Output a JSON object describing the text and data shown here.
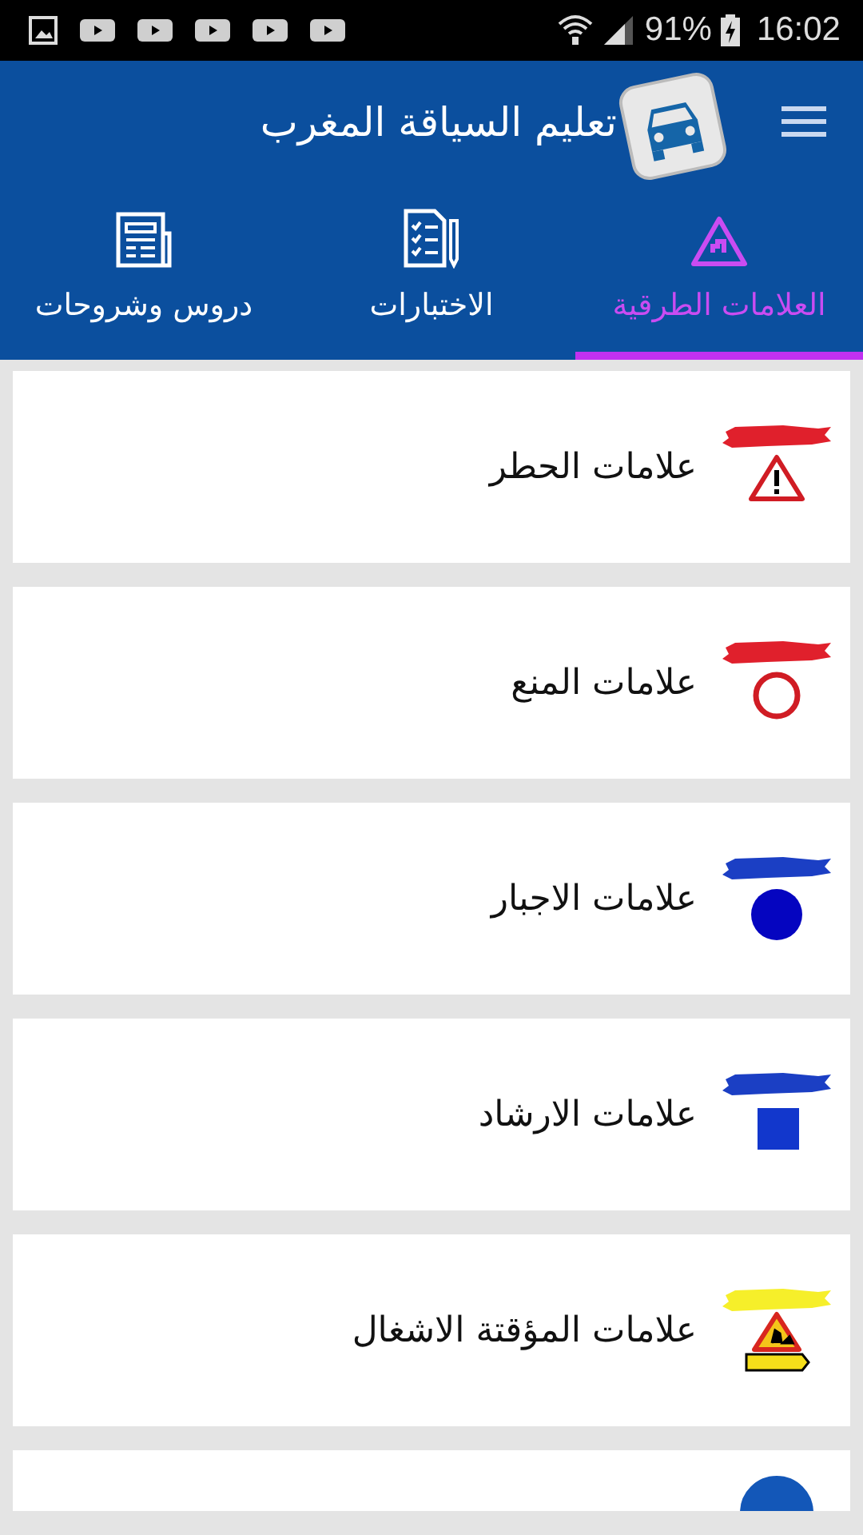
{
  "status_bar": {
    "battery": "91%",
    "time": "16:02"
  },
  "app_bar": {
    "title": "تعليم السياقة المغرب"
  },
  "tabs": [
    {
      "label": "العلامات الطرقية",
      "selected": true
    },
    {
      "label": "الاختبارات",
      "selected": false
    },
    {
      "label": "دروس وشروحات",
      "selected": false
    }
  ],
  "categories": [
    {
      "title": "علامات الحطر",
      "kind": "warning"
    },
    {
      "title": "علامات المنع",
      "kind": "prohibition"
    },
    {
      "title": "علامات الاجبار",
      "kind": "mandatory"
    },
    {
      "title": "علامات الارشاد",
      "kind": "information"
    },
    {
      "title": "علامات المؤقتة الاشغال",
      "kind": "roadwork"
    },
    {
      "kind": "round"
    }
  ]
}
